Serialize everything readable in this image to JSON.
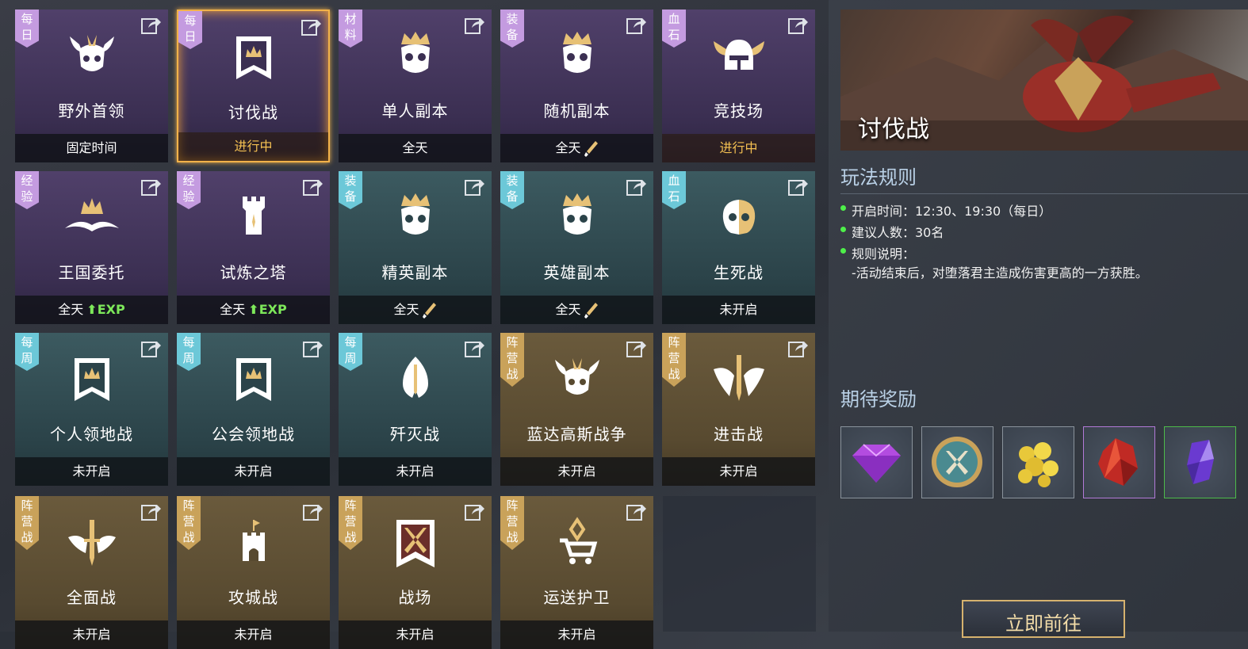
{
  "tiles": [
    {
      "tag": "每\n日",
      "name": "野外首领",
      "status": "固定时间"
    },
    {
      "tag": "每\n日",
      "name": "讨伐战",
      "status": "进行中"
    },
    {
      "tag": "材\n料",
      "name": "单人副本",
      "status": "全天"
    },
    {
      "tag": "装\n备",
      "name": "随机副本",
      "status": "全天"
    },
    {
      "tag": "血\n石",
      "name": "竞技场",
      "status": "进行中"
    },
    {
      "tag": "经\n验",
      "name": "王国委托",
      "status": "全天",
      "status_extra": "EXP"
    },
    {
      "tag": "经\n验",
      "name": "试炼之塔",
      "status": "全天",
      "status_extra": "EXP"
    },
    {
      "tag": "装\n备",
      "name": "精英副本",
      "status": "全天"
    },
    {
      "tag": "装\n备",
      "name": "英雄副本",
      "status": "全天"
    },
    {
      "tag": "血\n石",
      "name": "生死战",
      "status": "未开启"
    },
    {
      "tag": "每\n周",
      "name": "个人领地战",
      "status": "未开启"
    },
    {
      "tag": "每\n周",
      "name": "公会领地战",
      "status": "未开启"
    },
    {
      "tag": "每\n周",
      "name": "歼灭战",
      "status": "未开启"
    },
    {
      "tag": "阵\n营\n战",
      "name": "蓝达高斯战争",
      "status": "未开启"
    },
    {
      "tag": "阵\n营\n战",
      "name": "进击战",
      "status": "未开启"
    },
    {
      "tag": "阵\n营\n战",
      "name": "全面战",
      "status": "未开启"
    },
    {
      "tag": "阵\n营\n战",
      "name": "攻城战",
      "status": "未开启"
    },
    {
      "tag": "阵\n营\n战",
      "name": "战场",
      "status": "未开启"
    },
    {
      "tag": "阵\n营\n战",
      "name": "运送护卫",
      "status": "未开启"
    }
  ],
  "detail": {
    "title": "讨伐战",
    "rules_heading": "玩法规则",
    "rules": [
      "开启时间：12:30、19:30（每日）",
      "建议人数：30名",
      "规则说明："
    ],
    "rule_desc": "-活动结束后，对堕落君主造成伤害更高的一方获胜。",
    "rewards_heading": "期待奖励",
    "go_button": "立即前往"
  },
  "colors": {
    "accent_gold": "#f5c152",
    "exp_green": "#7de85a",
    "active_border": "#f2b24a",
    "rule_dot": "#4ef04a"
  },
  "reward_icons": [
    "purple-gem-icon",
    "crossed-swords-medal-icon",
    "gold-coins-icon",
    "red-crystal-icon",
    "purple-crystal-icon"
  ]
}
